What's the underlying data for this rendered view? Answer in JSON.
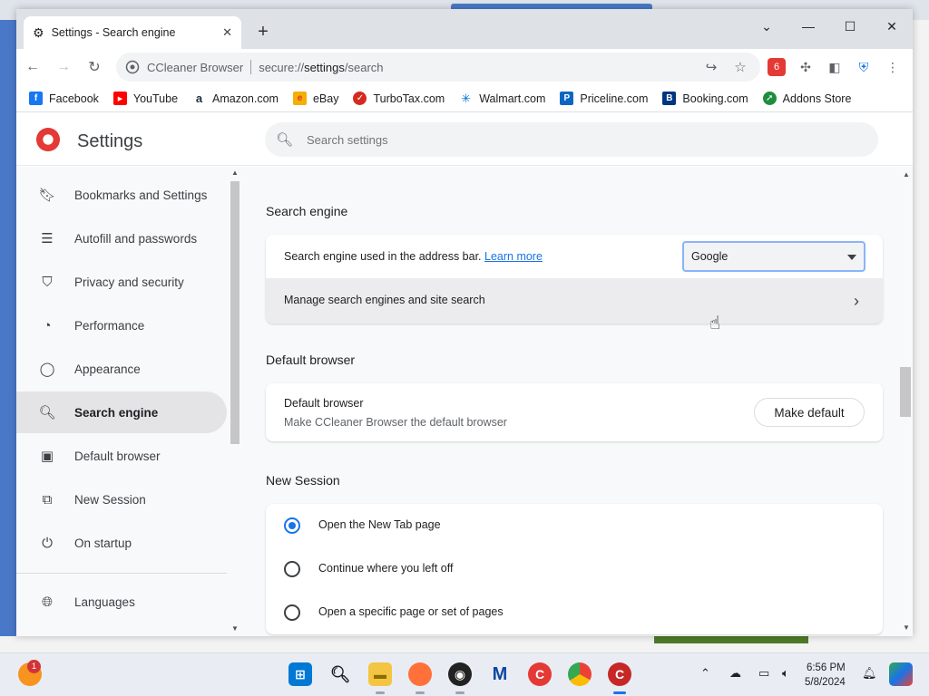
{
  "browser": {
    "tab_title": "Settings - Search engine",
    "omnibox_brand": "CCleaner Browser",
    "url_scheme": "secure://",
    "url_host": "settings",
    "url_path": "/search"
  },
  "bookmarks": [
    {
      "label": "Facebook",
      "color": "#1877f2",
      "glyph": "f"
    },
    {
      "label": "YouTube",
      "color": "#ff0000",
      "glyph": "▶"
    },
    {
      "label": "Amazon.com",
      "color": "#232f3e",
      "glyph": "a"
    },
    {
      "label": "eBay",
      "color": "#e53238",
      "glyph": "e"
    },
    {
      "label": "TurboTax.com",
      "color": "#d52b1e",
      "glyph": "✓"
    },
    {
      "label": "Walmart.com",
      "color": "#0071ce",
      "glyph": "✳"
    },
    {
      "label": "Priceline.com",
      "color": "#0a66c2",
      "glyph": "P"
    },
    {
      "label": "Booking.com",
      "color": "#003580",
      "glyph": "B"
    },
    {
      "label": "Addons Store",
      "color": "#1e8e3e",
      "glyph": "➚"
    }
  ],
  "settings": {
    "title": "Settings",
    "search_placeholder": "Search settings"
  },
  "sidebar": {
    "items": [
      {
        "label": "Bookmarks and Settings",
        "icon": "bookmark-icon"
      },
      {
        "label": "Autofill and passwords",
        "icon": "autofill-icon"
      },
      {
        "label": "Privacy and security",
        "icon": "shield-icon"
      },
      {
        "label": "Performance",
        "icon": "speedometer-icon"
      },
      {
        "label": "Appearance",
        "icon": "palette-icon"
      },
      {
        "label": "Search engine",
        "icon": "search-icon",
        "active": true
      },
      {
        "label": "Default browser",
        "icon": "browser-icon"
      },
      {
        "label": "New Session",
        "icon": "session-icon"
      },
      {
        "label": "On startup",
        "icon": "power-icon"
      },
      {
        "label": "Languages",
        "icon": "globe-icon"
      }
    ]
  },
  "search_engine": {
    "heading": "Search engine",
    "address_bar_label": "Search engine used in the address bar.",
    "learn_more": "Learn more",
    "selected_engine": "Google",
    "manage_label": "Manage search engines and site search"
  },
  "default_browser": {
    "heading": "Default browser",
    "title": "Default browser",
    "subtitle": "Make CCleaner Browser the default browser",
    "button": "Make default"
  },
  "new_session": {
    "heading": "New Session",
    "options": [
      {
        "label": "Open the New Tab page",
        "checked": true
      },
      {
        "label": "Continue where you left off",
        "checked": false
      },
      {
        "label": "Open a specific page or set of pages",
        "checked": false
      }
    ]
  },
  "taskbar": {
    "time": "6:56 PM",
    "date": "5/8/2024",
    "notification_count": "1"
  },
  "colors": {
    "accent": "#1a73e8",
    "active_nav_bg": "#e4e4e6"
  }
}
